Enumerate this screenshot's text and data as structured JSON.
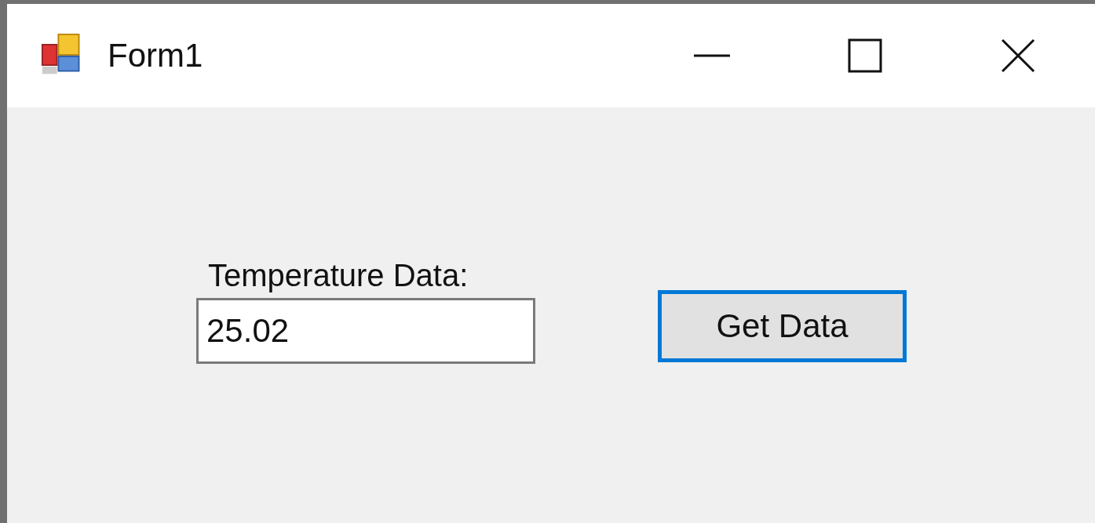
{
  "window": {
    "title": "Form1"
  },
  "label": "Temperature Data:",
  "field": {
    "value": "25.02"
  },
  "button": {
    "label": "Get Data",
    "focused": true
  }
}
